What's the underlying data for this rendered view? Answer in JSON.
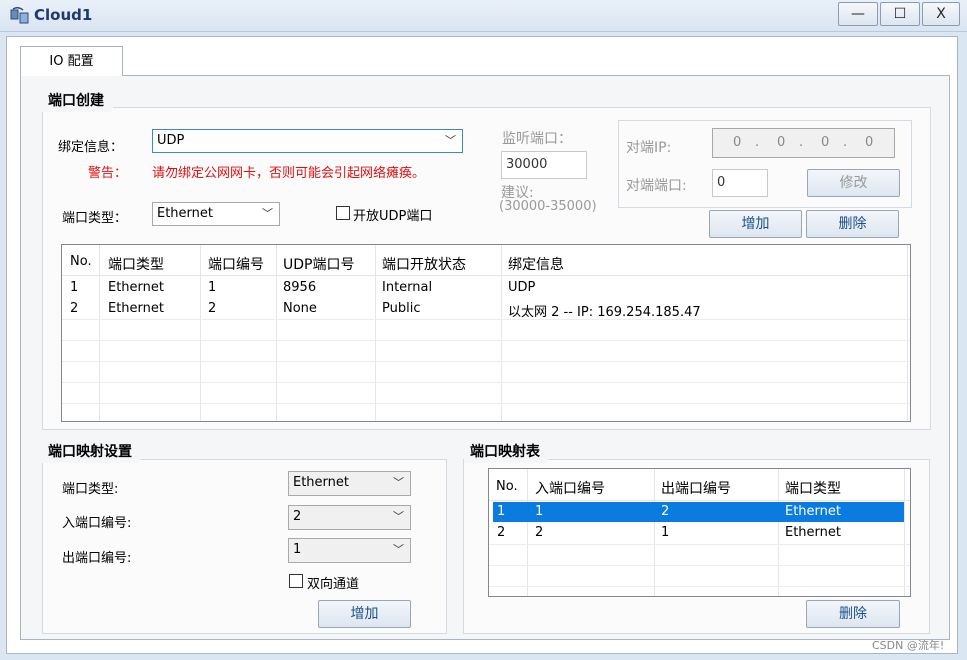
{
  "window": {
    "title": "Cloud1",
    "min": "—",
    "max": "☐",
    "close": "X"
  },
  "tabs": [
    "IO 配置"
  ],
  "port_creation": {
    "group_title": "端口创建",
    "binding_label": "绑定信息：",
    "binding_value": "UDP",
    "warning_label": "警告：",
    "warning_text": "请勿绑定公网网卡，否则可能会引起网络瘫痪。",
    "port_type_label": "端口类型：",
    "port_type_value": "Ethernet",
    "open_udp_label": "开放UDP端口",
    "open_udp_checked": false,
    "listen_port_label": "监听端口：",
    "listen_port_value": "30000",
    "suggest_label": "建议:",
    "suggest_range": "(30000-35000)",
    "peer_ip_label": "对端IP:",
    "peer_ip_octets": [
      "0",
      "0",
      "0",
      "0"
    ],
    "peer_port_label": "对端端口:",
    "peer_port_value": "0",
    "modify_button": "修改",
    "add_button": "增加",
    "delete_button": "删除",
    "table": {
      "headers": [
        "No.",
        "端口类型",
        "端口编号",
        "UDP端口号",
        "端口开放状态",
        "绑定信息"
      ],
      "rows": [
        [
          "1",
          "Ethernet",
          "1",
          "8956",
          "Internal",
          "UDP"
        ],
        [
          "2",
          "Ethernet",
          "2",
          "None",
          "Public",
          "以太网 2 -- IP: 169.254.185.47"
        ]
      ]
    }
  },
  "port_mapping_settings": {
    "group_title": "端口映射设置",
    "port_type_label": "端口类型:",
    "port_type_value": "Ethernet",
    "in_port_label": "入端口编号:",
    "in_port_value": "2",
    "out_port_label": "出端口编号:",
    "out_port_value": "1",
    "bidirectional_label": "双向通道",
    "bidirectional_checked": false,
    "add_button": "增加"
  },
  "port_mapping_table": {
    "group_title": "端口映射表",
    "headers": [
      "No.",
      "入端口编号",
      "出端口编号",
      "端口类型"
    ],
    "rows": [
      [
        "1",
        "1",
        "2",
        "Ethernet"
      ],
      [
        "2",
        "2",
        "1",
        "Ethernet"
      ]
    ],
    "selected_row": 0,
    "delete_button": "删除"
  },
  "watermark": "CSDN @流年!",
  "colors": {
    "selection": "#0a7be0",
    "warning": "#e01010",
    "button_text": "#1a4f8a"
  }
}
